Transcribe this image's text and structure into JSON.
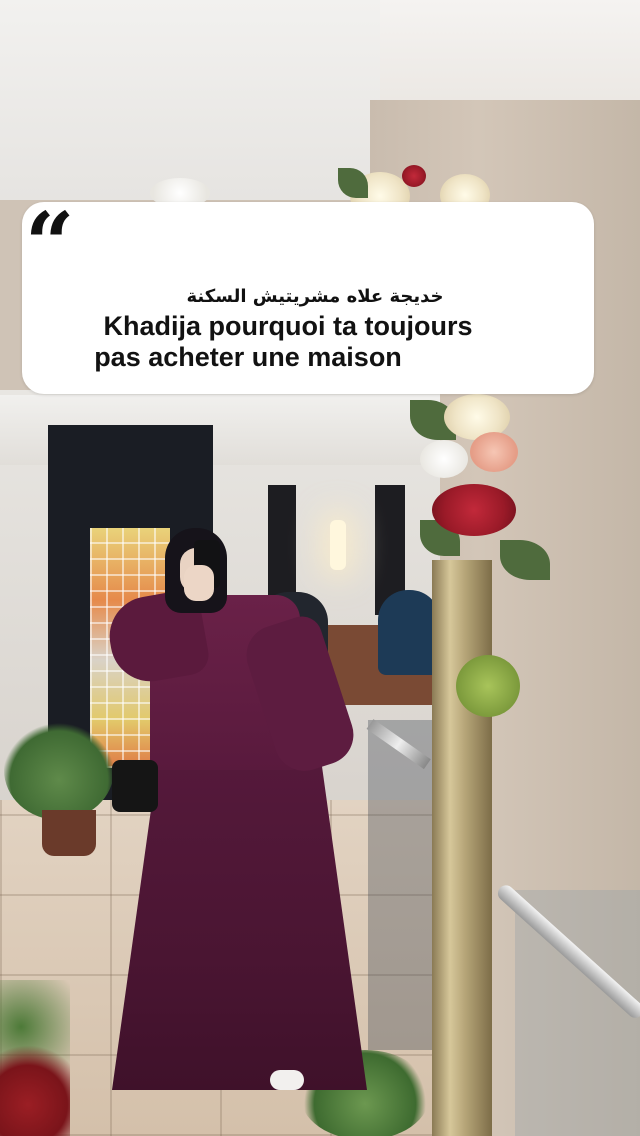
{
  "quote": {
    "arabic_name": "خديجة علاه مشريتيش السكنة",
    "lines": [
      "Khadija pourquoi ta toujours",
      "pas acheter une maison"
    ]
  },
  "colors": {
    "dress": "#55193b",
    "card_background": "#ffffff",
    "text": "#111111"
  }
}
